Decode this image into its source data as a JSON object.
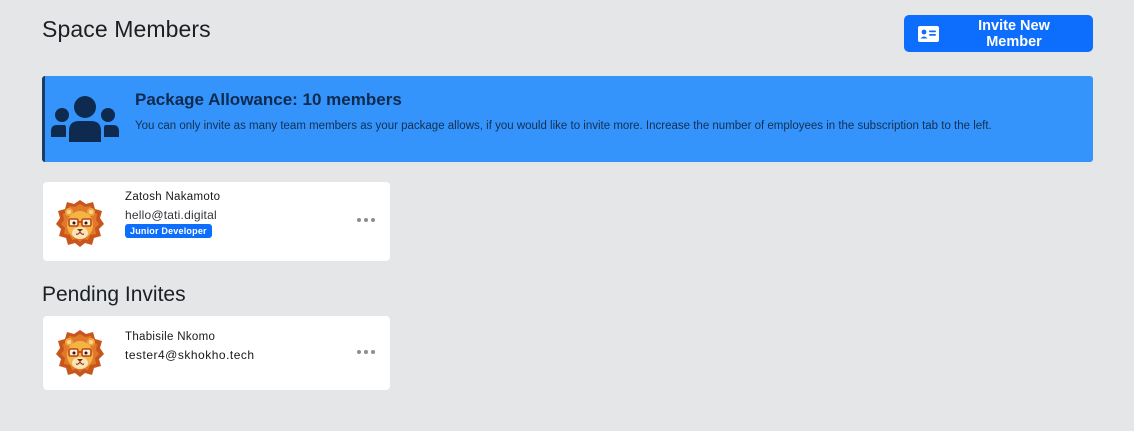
{
  "header": {
    "title": "Space Members",
    "invite_button_label": "Invite New Member",
    "invite_button_icon": "id-card-icon"
  },
  "banner": {
    "icon": "users-group-icon",
    "title": "Package Allowance: 10 members",
    "text": "You can only invite as many team members as your package allows, if you would like to invite more. Increase the number of employees in the subscription tab to the left."
  },
  "members": [
    {
      "name": "Zatosh Nakamoto",
      "email": "hello@tati.digital",
      "role": "Junior Developer",
      "avatar": "lion-avatar"
    }
  ],
  "pending": {
    "title": "Pending Invites",
    "invites": [
      {
        "name": "Thabisile Nkomo",
        "email": "tester4@skhokho.tech",
        "avatar": "lion-avatar"
      }
    ]
  },
  "colors": {
    "accent": "#0d6efd",
    "banner_bg": "#3494fb",
    "page_bg": "#e4e6e8"
  }
}
